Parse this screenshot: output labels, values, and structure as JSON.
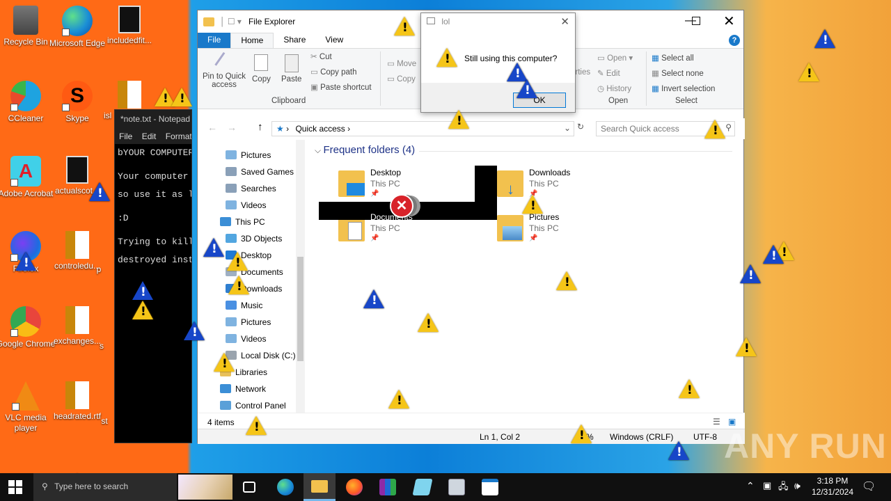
{
  "desktop": {
    "icons": [
      {
        "label": "Recycle Bin"
      },
      {
        "label": "Microsoft Edge"
      },
      {
        "label": "includedfit..."
      },
      {
        "label": "CCleaner"
      },
      {
        "label": "Skype"
      },
      {
        "label": "isl"
      },
      {
        "label": "Adobe Acrobat"
      },
      {
        "label": "actualscot..."
      },
      {
        "label": "Firefox"
      },
      {
        "label": "controledu..."
      },
      {
        "label": "p"
      },
      {
        "label": "Google Chrome"
      },
      {
        "label": "exchanges..."
      },
      {
        "label": "s"
      },
      {
        "label": "VLC media player"
      },
      {
        "label": "headrated.rtf"
      },
      {
        "label": "st"
      }
    ]
  },
  "notepad": {
    "title": "*note.txt - Notepad",
    "menu": [
      "File",
      "Edit",
      "Format"
    ],
    "lines": [
      "bYOUR COMPUTER",
      "",
      "Your computer w",
      "so use it as lo",
      "",
      ":D",
      "",
      "Trying to kill",
      "destroyed insta"
    ]
  },
  "explorer": {
    "title": "File Explorer",
    "tabs": {
      "file": "File",
      "home": "Home",
      "share": "Share",
      "view": "View"
    },
    "ribbon": {
      "pin_label": "Pin to Quick access",
      "copy": "Copy",
      "paste": "Paste",
      "cut": "Cut",
      "copy_path": "Copy path",
      "paste_shortcut": "Paste shortcut",
      "clipboard_group": "Clipboard",
      "move": "Move",
      "copy_to": "Copy",
      "properties_partial": "erties",
      "open": "Open",
      "edit": "Edit",
      "history": "History",
      "open_group": "Open",
      "select_all": "Select all",
      "select_none": "Select none",
      "invert_selection": "Invert selection",
      "select_group": "Select"
    },
    "address": {
      "path": "Quick access",
      "search_placeholder": "Search Quick access"
    },
    "nav": [
      {
        "label": "Pictures",
        "color": "#7fb3e0"
      },
      {
        "label": "Saved Games",
        "color": "#8aa0b8"
      },
      {
        "label": "Searches",
        "color": "#8aa0b8"
      },
      {
        "label": "Videos",
        "color": "#7fb3e0"
      },
      {
        "label": "This PC",
        "color": "#3b8ed6"
      },
      {
        "label": "3D Objects",
        "color": "#52a6e0"
      },
      {
        "label": "Desktop",
        "color": "#1e7ad6"
      },
      {
        "label": "Documents",
        "color": "#9fb0c4"
      },
      {
        "label": "Downloads",
        "color": "#2f7fd0"
      },
      {
        "label": "Music",
        "color": "#4a90e2"
      },
      {
        "label": "Pictures",
        "color": "#7fb3e0"
      },
      {
        "label": "Videos",
        "color": "#7fb3e0"
      },
      {
        "label": "Local Disk (C:)",
        "color": "#9aa4ae"
      },
      {
        "label": "Libraries",
        "color": "#e8c05a"
      },
      {
        "label": "Network",
        "color": "#3b8ed6"
      },
      {
        "label": "Control Panel",
        "color": "#5aa0d8"
      }
    ],
    "section_header": "Frequent folders (4)",
    "folders": [
      {
        "name": "Desktop",
        "location": "This PC"
      },
      {
        "name": "Downloads",
        "location": "This PC"
      },
      {
        "name": "Documents",
        "location": "This PC"
      },
      {
        "name": "Pictures",
        "location": "This PC"
      }
    ],
    "item_count": "4 items",
    "statusbar": {
      "position": "Ln 1, Col 2",
      "percent": "%",
      "line_ending": "Windows (CRLF)",
      "encoding": "UTF-8"
    }
  },
  "dialog": {
    "title": "lol",
    "message": "Still using this computer?",
    "ok": "OK"
  },
  "taskbar": {
    "search_placeholder": "Type here to search",
    "time": "3:18 PM",
    "date": "12/31/2024"
  },
  "watermark": "ANY RUN",
  "colors": {
    "accent": "#1979ca",
    "warning": "#f5c518",
    "info": "#1746c8",
    "error": "#d8232a"
  }
}
